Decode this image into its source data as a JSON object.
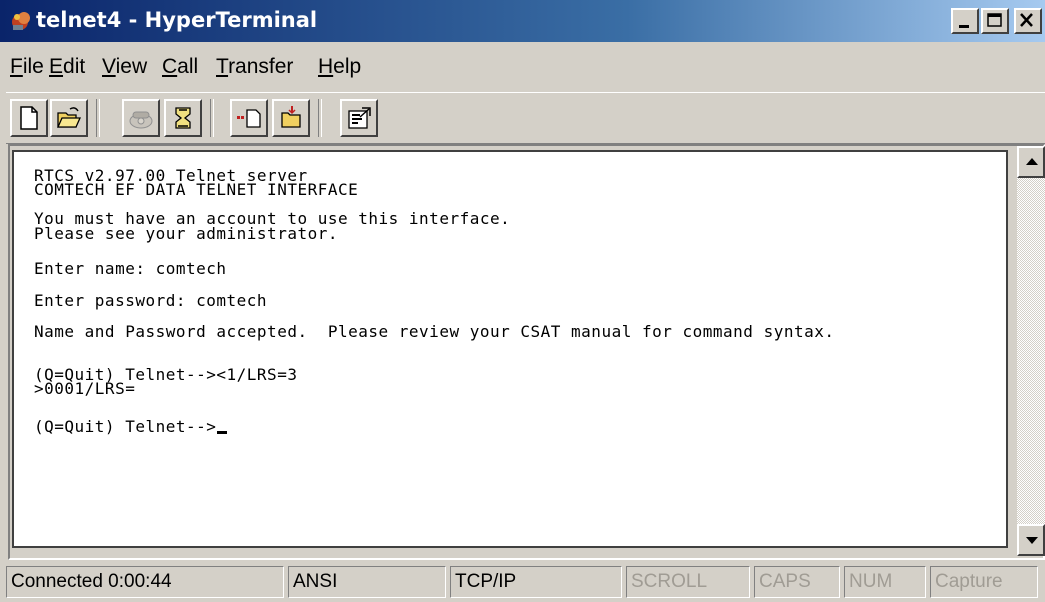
{
  "window": {
    "title": "telnet4 - HyperTerminal",
    "controls": {
      "minimize": "_",
      "maximize": "□",
      "close": "×"
    }
  },
  "menu": {
    "items": [
      {
        "label": "File",
        "underline": "F",
        "rest": "ile"
      },
      {
        "label": "Edit",
        "underline": "E",
        "rest": "dit"
      },
      {
        "label": "View",
        "underline": "V",
        "rest": "iew"
      },
      {
        "label": "Call",
        "underline": "C",
        "rest": "all"
      },
      {
        "label": "Transfer",
        "underline": "T",
        "rest": "ransfer"
      },
      {
        "label": "Help",
        "underline": "H",
        "rest": "elp"
      }
    ]
  },
  "toolbar": {
    "buttons": [
      "new-icon",
      "open-icon",
      "call-icon",
      "disconnect-icon",
      "send-icon",
      "receive-icon",
      "properties-icon"
    ]
  },
  "terminal": {
    "lines": [
      "RTCS v2.97.00 Telnet server",
      "COMTECH EF DATA TELNET INTERFACE",
      "You must have an account to use this interface.",
      "Please see your administrator.",
      "Enter name: comtech",
      "Enter password: comtech",
      "Name and Password accepted.  Please review your CSAT manual for command syntax.",
      "(Q=Quit) Telnet-->&lt;1/LRS=3",
      ">0001/LRS=",
      "(Q=Quit) Telnet-->"
    ]
  },
  "status": {
    "connection": "Connected 0:00:44",
    "emulation": "ANSI",
    "protocol": "TCP/IP",
    "scroll": "SCROLL",
    "caps": "CAPS",
    "num": "NUM",
    "capture": "Capture"
  }
}
